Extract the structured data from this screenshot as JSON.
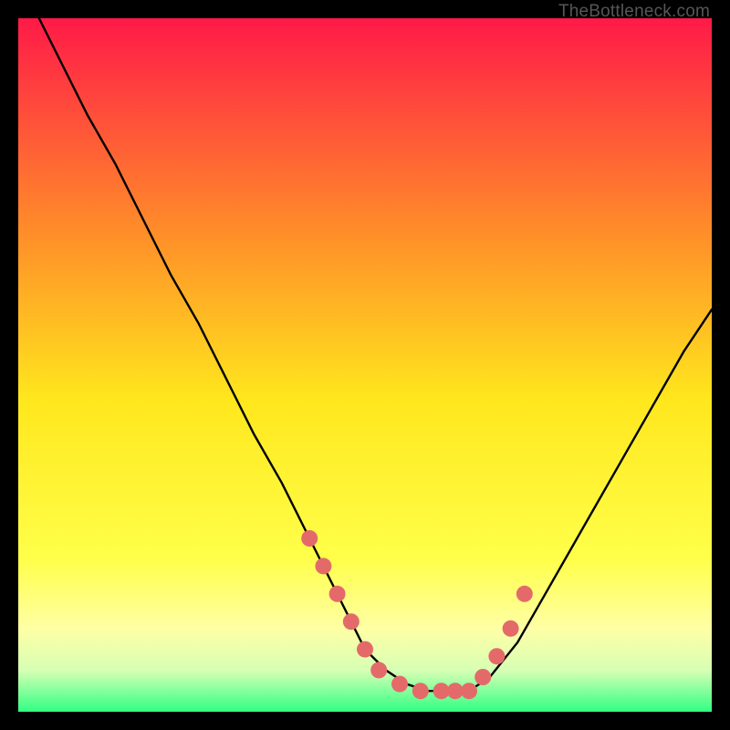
{
  "attribution": "TheBottleneck.com",
  "colors": {
    "background": "#000000",
    "gradient_top": "#ff1a48",
    "gradient_mid_upper": "#ff8a2a",
    "gradient_mid": "#ffe71d",
    "gradient_lower": "#ffff4a",
    "gradient_pale": "#ffffa5",
    "gradient_near_bottom": "#d7ffb4",
    "gradient_bottom": "#31ff83",
    "curve": "#000000",
    "marker_fill": "#e46a6a",
    "marker_stroke": "#b54f4f"
  },
  "chart_data": {
    "type": "line",
    "title": "",
    "xlabel": "",
    "ylabel": "",
    "xlim": [
      0,
      100
    ],
    "ylim": [
      0,
      100
    ],
    "grid": false,
    "legend": false,
    "series": [
      {
        "name": "bottleneck-curve",
        "x": [
          3,
          6,
          10,
          14,
          18,
          22,
          26,
          30,
          34,
          38,
          42,
          45,
          48,
          50,
          53,
          56,
          59,
          62,
          65,
          68,
          72,
          76,
          80,
          84,
          88,
          92,
          96,
          100
        ],
        "y": [
          100,
          94,
          86,
          79,
          71,
          63,
          56,
          48,
          40,
          33,
          25,
          19,
          13,
          9,
          6,
          4,
          3,
          3,
          3,
          5,
          10,
          17,
          24,
          31,
          38,
          45,
          52,
          58
        ]
      }
    ],
    "markers": {
      "name": "highlighted-points",
      "x": [
        42,
        44,
        46,
        48,
        50,
        52,
        55,
        58,
        61,
        63,
        65,
        67,
        69,
        71,
        73
      ],
      "y": [
        25,
        21,
        17,
        13,
        9,
        6,
        4,
        3,
        3,
        3,
        3,
        5,
        8,
        12,
        17
      ]
    }
  }
}
